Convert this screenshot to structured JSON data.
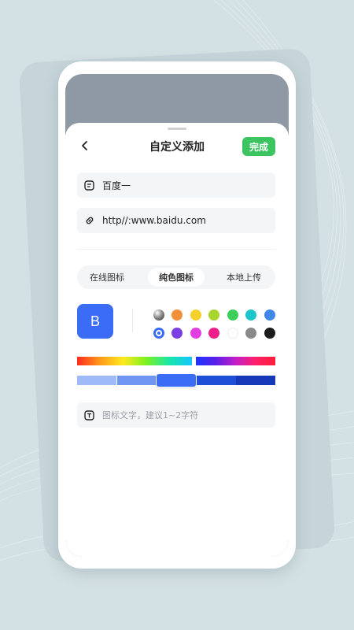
{
  "header": {
    "title": "自定义添加",
    "done_label": "完成"
  },
  "form": {
    "name_value": "百度一",
    "url_value": "http//:www.baidu.com",
    "icon_text_placeholder": "图标文字，建议1~2字符"
  },
  "tabs": [
    {
      "label": "在线图标",
      "active": false
    },
    {
      "label": "纯色图标",
      "active": true
    },
    {
      "label": "本地上传",
      "active": false
    }
  ],
  "preview": {
    "letter": "B",
    "color": "#3a6cf5"
  },
  "colors": {
    "row1": [
      "gradient-black",
      "#f0913a",
      "#f5d02f",
      "#a9d62e",
      "#3ecf5a",
      "#1ec4cc",
      "#3f88e8"
    ],
    "row2": [
      "#3a6cf5",
      "#7b3fe4",
      "#e23ee0",
      "#ee1f8b",
      "#ffffff",
      "#8a8a8a",
      "#1c1c1c"
    ],
    "selected": "#3a6cf5",
    "accent": "#3bc45f"
  },
  "shades": [
    "#9fbaf8",
    "#6e96f2",
    "#3a6cf5",
    "#1f4fd6",
    "#1538b8"
  ],
  "icons": [
    "back-arrow-icon",
    "name-field-icon",
    "link-icon",
    "text-icon"
  ]
}
